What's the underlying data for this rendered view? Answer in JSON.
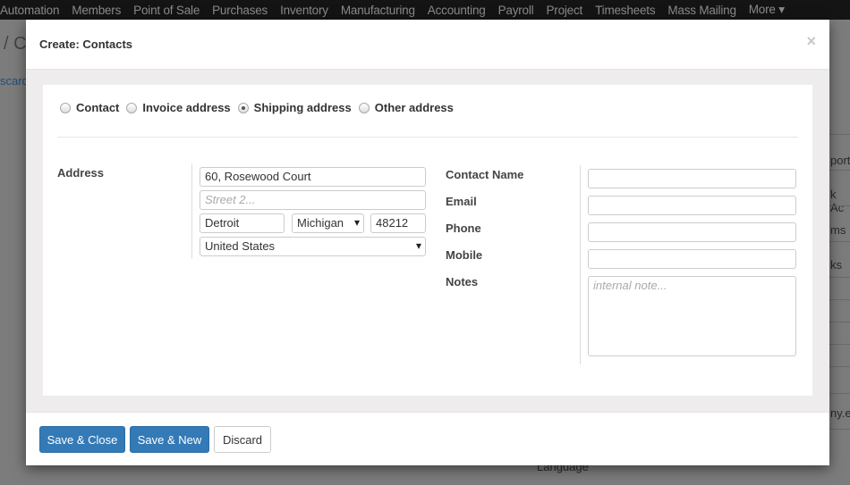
{
  "topnav": {
    "items": [
      "Automation",
      "Members",
      "Point of Sale",
      "Purchases",
      "Inventory",
      "Manufacturing",
      "Accounting",
      "Payroll",
      "Project",
      "Timesheets",
      "Mass Mailing",
      "More ▾"
    ]
  },
  "background": {
    "breadcrumb": "/ C",
    "discard": "scard",
    "right": [
      "portu",
      "k Ac",
      "ms",
      "ks",
      "ny.e"
    ],
    "language": "Language"
  },
  "modal": {
    "title": "Create: Contacts",
    "close": "×",
    "address_types": [
      {
        "label": "Contact",
        "selected": false
      },
      {
        "label": "Invoice address",
        "selected": false
      },
      {
        "label": "Shipping address",
        "selected": true
      },
      {
        "label": "Other address",
        "selected": false
      }
    ],
    "address": {
      "label": "Address",
      "street": "60, Rosewood Court",
      "street2_placeholder": "Street 2...",
      "city": "Detroit",
      "state": "Michigan",
      "zip": "48212",
      "country": "United States"
    },
    "fields": {
      "contact_name": "Contact Name",
      "email": "Email",
      "phone": "Phone",
      "mobile": "Mobile",
      "notes": "Notes",
      "notes_placeholder": "internal note..."
    },
    "buttons": {
      "save_close": "Save & Close",
      "save_new": "Save & New",
      "discard": "Discard"
    }
  }
}
